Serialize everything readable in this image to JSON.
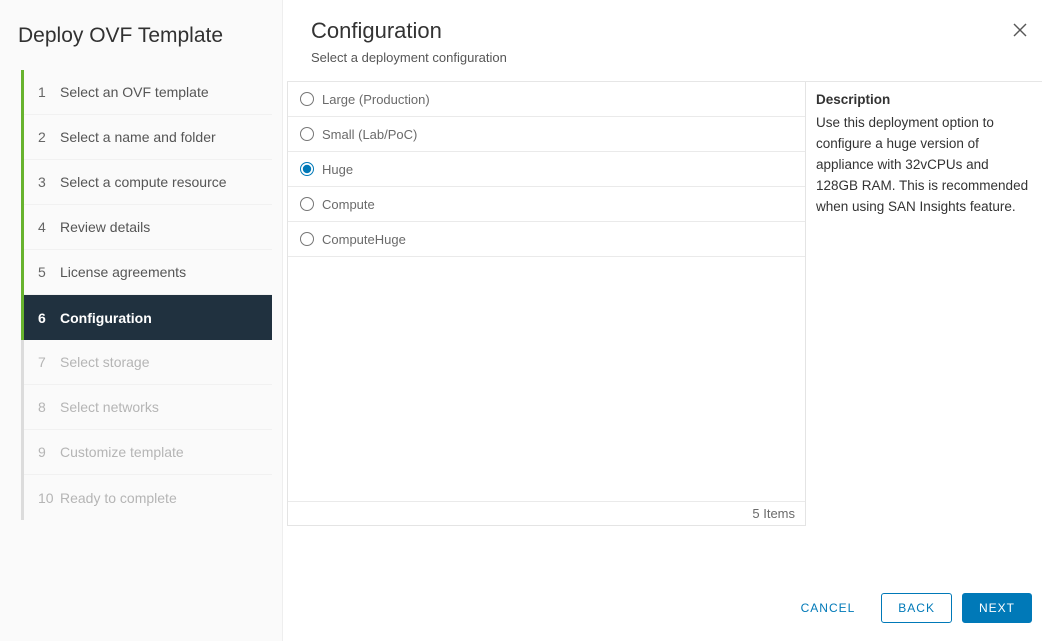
{
  "dialog": {
    "title": "Deploy OVF Template"
  },
  "steps": [
    {
      "num": "1",
      "label": "Select an OVF template",
      "state": "done"
    },
    {
      "num": "2",
      "label": "Select a name and folder",
      "state": "done"
    },
    {
      "num": "3",
      "label": "Select a compute resource",
      "state": "done"
    },
    {
      "num": "4",
      "label": "Review details",
      "state": "done"
    },
    {
      "num": "5",
      "label": "License agreements",
      "state": "done"
    },
    {
      "num": "6",
      "label": "Configuration",
      "state": "active"
    },
    {
      "num": "7",
      "label": "Select storage",
      "state": "future"
    },
    {
      "num": "8",
      "label": "Select networks",
      "state": "future"
    },
    {
      "num": "9",
      "label": "Customize template",
      "state": "future"
    },
    {
      "num": "10",
      "label": "Ready to complete",
      "state": "future"
    }
  ],
  "page": {
    "title": "Configuration",
    "subtitle": "Select a deployment configuration"
  },
  "options": [
    {
      "label": "Large (Production)",
      "selected": false
    },
    {
      "label": "Small (Lab/PoC)",
      "selected": false
    },
    {
      "label": "Huge",
      "selected": true
    },
    {
      "label": "Compute",
      "selected": false
    },
    {
      "label": "ComputeHuge",
      "selected": false
    }
  ],
  "options_footer": "5 Items",
  "description": {
    "title": "Description",
    "body": "Use this deployment option to configure a huge version of appliance with 32vCPUs and 128GB RAM. This is recommended when using SAN Insights feature."
  },
  "buttons": {
    "cancel": "CANCEL",
    "back": "BACK",
    "next": "NEXT"
  }
}
